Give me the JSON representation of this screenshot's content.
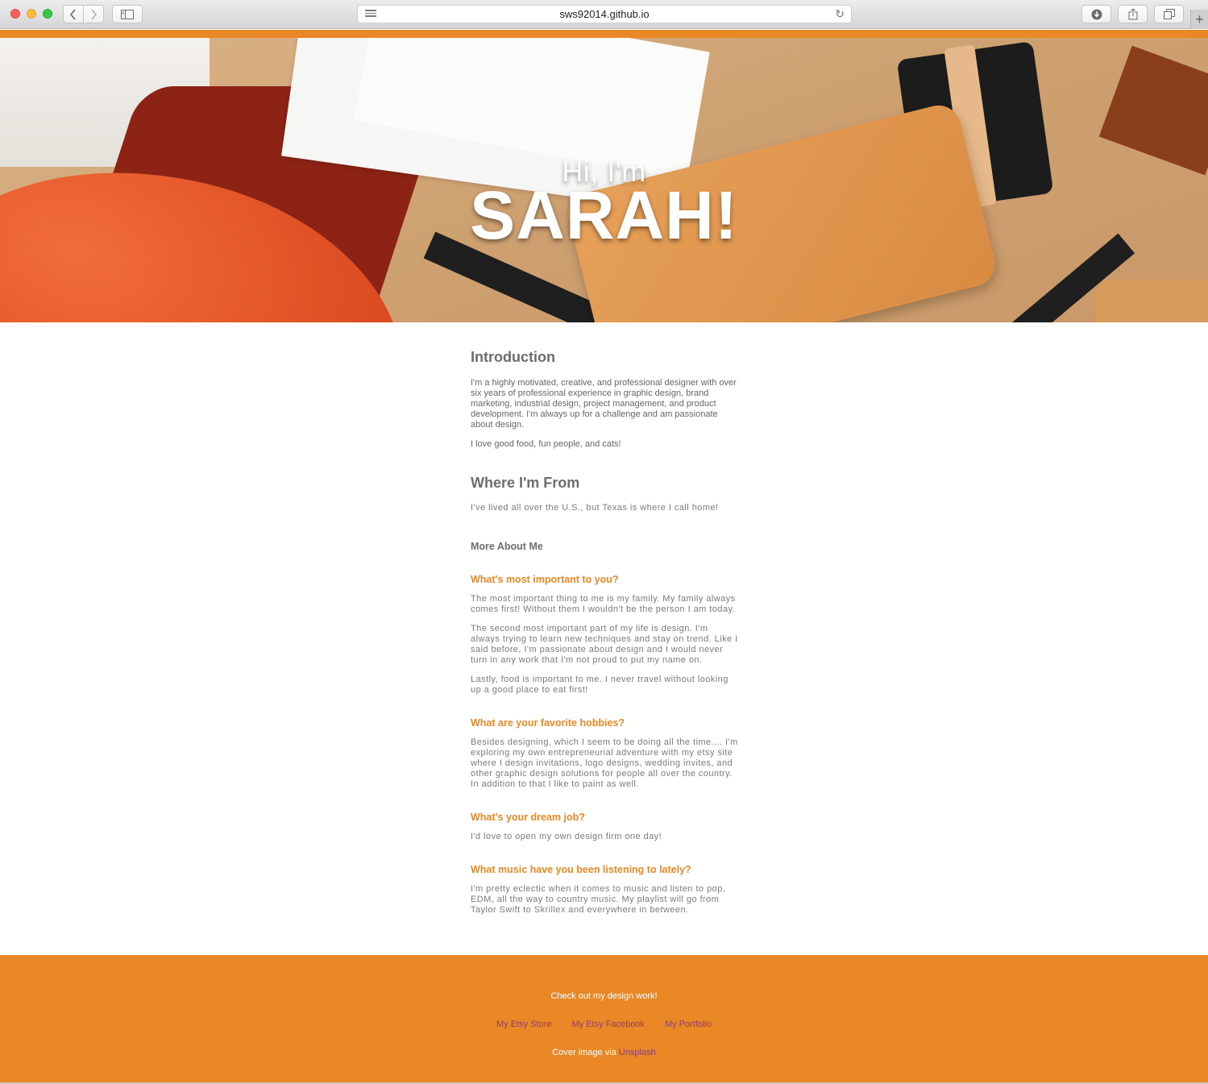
{
  "browser": {
    "url": "sws92014.github.io",
    "icons": [
      "chevron-left-icon",
      "chevron-right-icon",
      "sidebar-icon",
      "reader-icon",
      "reload-icon",
      "download-icon",
      "share-icon",
      "tabs-icon",
      "plus-icon"
    ]
  },
  "hero": {
    "greeting": "Hi, I'm",
    "name": "SARAH!"
  },
  "intro": {
    "heading": "Introduction",
    "p1": "I'm a highly motivated, creative, and professional designer with over six years of professional experience in graphic design, brand marketing, industrial design, project management, and product development. I'm always up for a challenge and am passionate about design.",
    "p2": "I love good food, fun people, and cats!"
  },
  "where": {
    "heading": "Where I'm From",
    "text": "I've lived all over the U.S., but Texas is where I call home!"
  },
  "more": {
    "heading": "More About Me",
    "q1": "What's most important to you?",
    "a1p1": "The most important thing to me is my family. My family always comes first! Without them I wouldn't be the person I am today.",
    "a1p2": "The second most important part of my life is design. I'm always trying to learn new techniques and stay on trend. Like I said before, I'm passionate about design and I would never turn in any work that I'm not proud to put my name on.",
    "a1p3": "Lastly, food is important to me. I never travel without looking up a good place to eat first!",
    "q2": "What are your favorite hobbies?",
    "a2": "Besides designing, which I seem to be doing all the time.... I'm exploring my own entrepreneurial adventure with my etsy site where I design invitations, logo designs, wedding invites, and other graphic design solutions for people all over the country. In addition to that I like to paint as well.",
    "q3": "What's your dream job?",
    "a3": "I'd love to open my own design firm one day!",
    "q4": "What music have you been listening to lately?",
    "a4": "I'm pretty eclectic when it comes to music and listen to pop, EDM, all the way to country music. My playlist will go from Taylor Swift to Skrillex and everywhere in between."
  },
  "footer": {
    "cta": "Check out my design work!",
    "links": [
      "My Etsy Store",
      "My Etsy Facebook",
      "My Portfolio"
    ],
    "cover_prefix": "Cover image via",
    "cover_link": "Unsplash"
  },
  "colors": {
    "accent": "#e98824",
    "link": "#8e3a7a",
    "text": "#6f6f6f"
  }
}
